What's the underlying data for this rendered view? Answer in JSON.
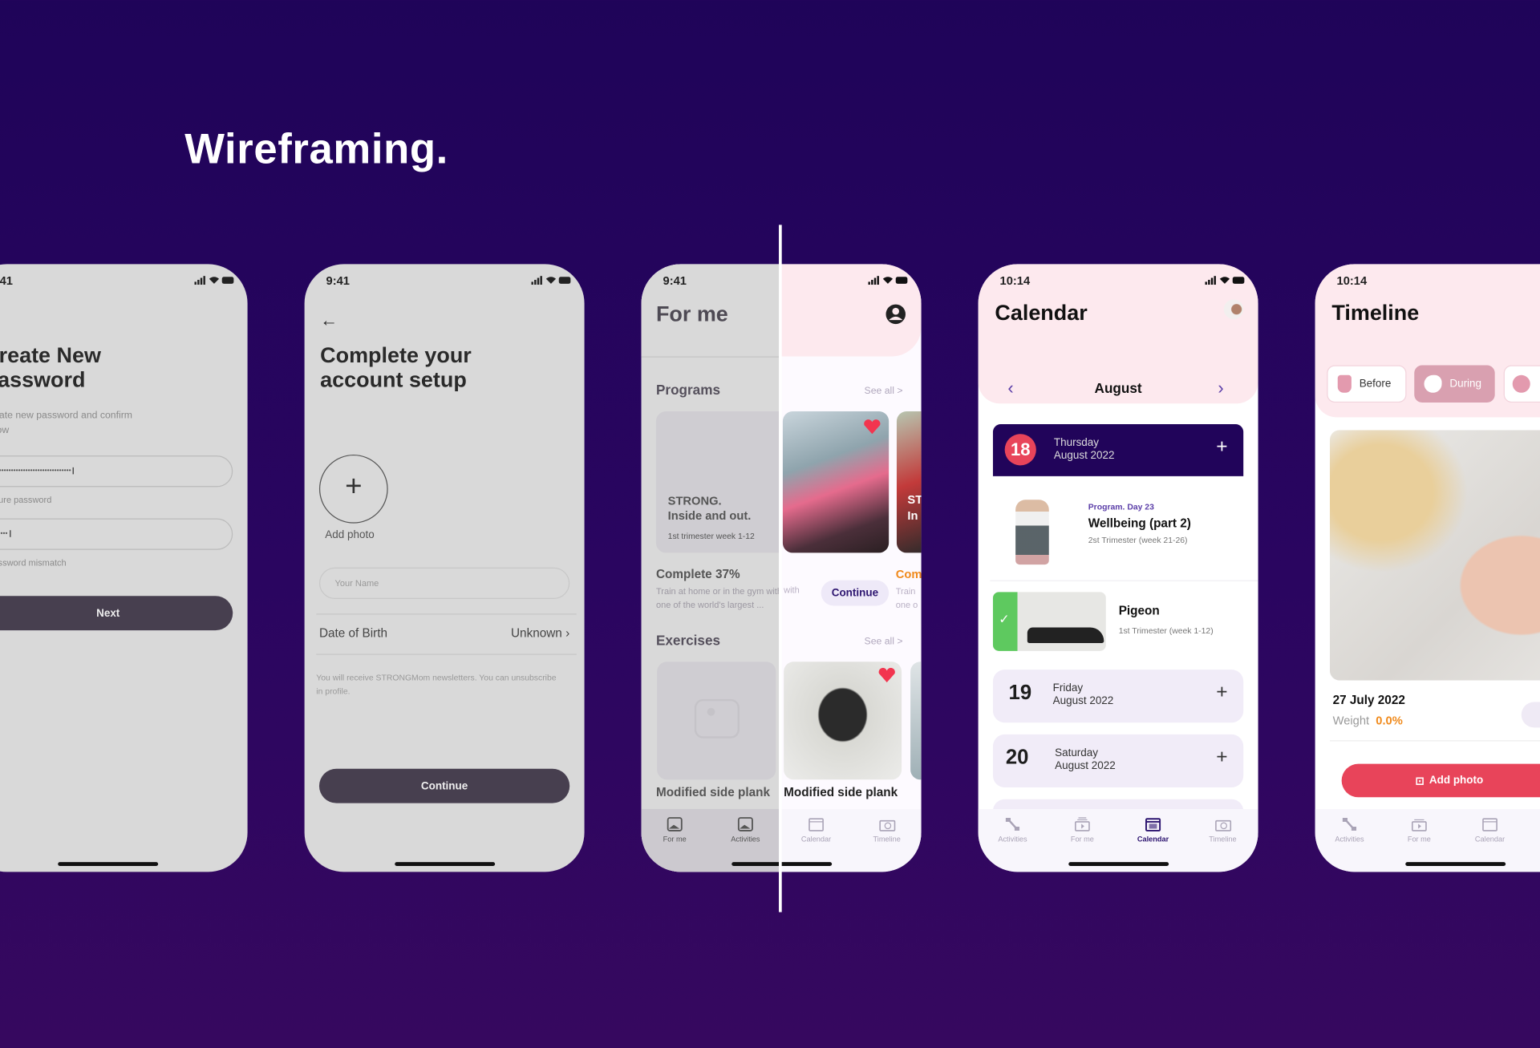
{
  "page_title": "Wireframing.",
  "colors": {
    "background": "#24055c",
    "wire_gray": "#d9d9d9",
    "dark_button": "#473f4f",
    "navy": "#21045a",
    "accent_red": "#e8445a",
    "header_pink": "#fde9ee",
    "orange": "#f08a1c",
    "green": "#5ec95f"
  },
  "status": {
    "time_a": "9:41",
    "time_b": "10:14"
  },
  "password_screen": {
    "title_line1": "Create New",
    "title_line2": "Password",
    "subtitle": "Create new password and confirm below",
    "password_value": "••••••••••••••••••••••••••••••••",
    "password_hint": "Secure password",
    "confirm_value": "••••",
    "confirm_hint": "Password mismatch",
    "next_label": "Next"
  },
  "setup_screen": {
    "title_line1": "Complete your",
    "title_line2": "account setup",
    "add_photo": "Add photo",
    "name_placeholder": "Your Name",
    "dob_label": "Date of Birth",
    "dob_value": "Unknown",
    "disclaimer": "You will receive STRONGMom newsletters. You can unsubscribe in profile.",
    "continue_label": "Continue"
  },
  "forme_screen": {
    "title": "For me",
    "programs": "Programs",
    "see_all": "See all >",
    "card_line1": "STRONG.",
    "card_line2": "Inside and out.",
    "card_sub": "1st trimester week 1-12",
    "complete": "Complete 37%",
    "desc_line1": "Train at home or in the gym with",
    "desc_line2": "one of the world's largest ...",
    "continue_label": "Continue",
    "peek_complete": "Com",
    "peek_line1": "Train",
    "peek_line2": "one o",
    "peek_card1": "ST",
    "peek_card2": "In",
    "exercises": "Exercises",
    "exercise_name": "Modified side plank",
    "tabs": [
      "For me",
      "Activities",
      "Calendar",
      "Timeline"
    ]
  },
  "calendar_screen": {
    "title": "Calendar",
    "month": "August",
    "selected": {
      "day": "18",
      "weekday": "Thursday",
      "month_year": "August 2022"
    },
    "program_item": {
      "kicker": "Program. Day 23",
      "name": "Wellbeing (part 2)",
      "sub": "2st Trimester (week 21-26)"
    },
    "done_item": {
      "name": "Pigeon",
      "sub": "1st Trimester (week 1-12)",
      "completed": true
    },
    "days": [
      {
        "day": "19",
        "weekday": "Friday",
        "month_year": "August 2022"
      },
      {
        "day": "20",
        "weekday": "Saturday",
        "month_year": "August 2022"
      }
    ],
    "tabs": [
      "Activities",
      "For me",
      "Calendar",
      "Timeline"
    ],
    "active_tab": "Calendar"
  },
  "timeline_screen": {
    "title": "Timeline",
    "chips": [
      "Before",
      "During"
    ],
    "active_chip": "During",
    "date": "27 July 2022",
    "weight_label": "Weight",
    "weight_value": "0.0%",
    "add_photo": "Add photo",
    "tabs": [
      "Activities",
      "For me",
      "Calendar"
    ]
  }
}
